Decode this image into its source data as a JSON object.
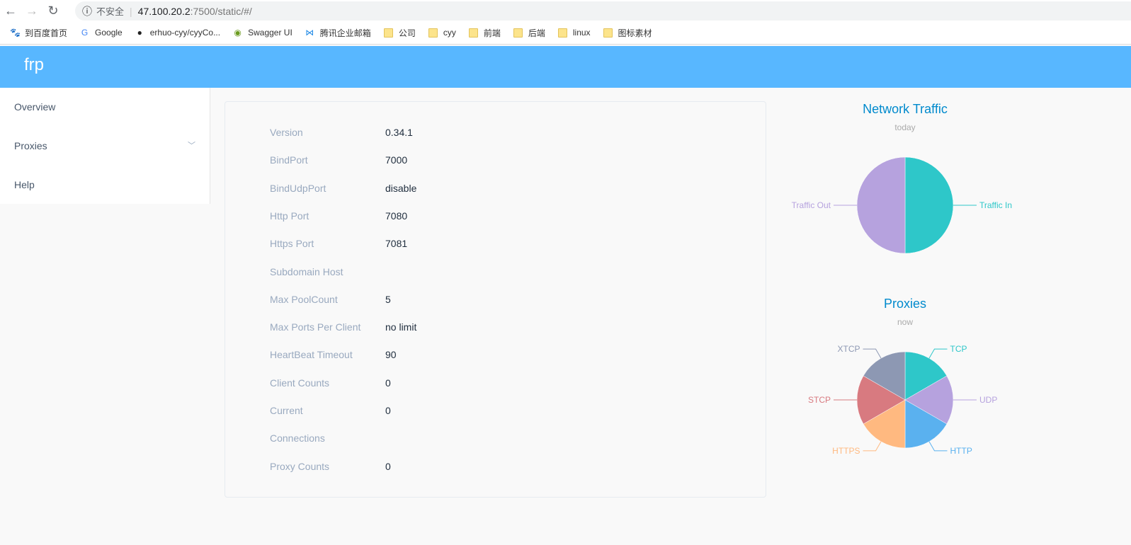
{
  "browser": {
    "url_security": "不安全",
    "url_host": "47.100.20.2",
    "url_path": ":7500/static/#/",
    "bookmarks": [
      {
        "label": "到百度首页",
        "icon": "baidu-icon"
      },
      {
        "label": "Google",
        "icon": "google-icon"
      },
      {
        "label": "erhuo-cyy/cyyCo...",
        "icon": "github-icon"
      },
      {
        "label": "Swagger UI",
        "icon": "swagger-icon"
      },
      {
        "label": "腾讯企业邮箱",
        "icon": "tencent-mail-icon"
      },
      {
        "label": "公司",
        "icon": "folder-icon"
      },
      {
        "label": "cyy",
        "icon": "folder-icon"
      },
      {
        "label": "前端",
        "icon": "folder-icon"
      },
      {
        "label": "后端",
        "icon": "folder-icon"
      },
      {
        "label": "linux",
        "icon": "folder-icon"
      },
      {
        "label": "图标素材",
        "icon": "folder-icon"
      }
    ]
  },
  "header": {
    "title": "frp",
    "color": "#58b7ff"
  },
  "sidebar": {
    "items": [
      {
        "label": "Overview"
      },
      {
        "label": "Proxies"
      },
      {
        "label": "Help"
      }
    ]
  },
  "info": [
    {
      "k": "Version",
      "v": "0.34.1"
    },
    {
      "k": "BindPort",
      "v": "7000"
    },
    {
      "k": "BindUdpPort",
      "v": "disable"
    },
    {
      "k": "Http Port",
      "v": "7080"
    },
    {
      "k": "Https Port",
      "v": "7081"
    },
    {
      "k": "Subdomain Host",
      "v": ""
    },
    {
      "k": "Max PoolCount",
      "v": "5"
    },
    {
      "k": "Max Ports Per Client",
      "v": "no limit"
    },
    {
      "k": "HeartBeat Timeout",
      "v": "90"
    },
    {
      "k": "Client Counts",
      "v": "0"
    },
    {
      "k": "Current",
      "v": "0"
    },
    {
      "k": "Connections",
      "v": ""
    },
    {
      "k": "Proxy Counts",
      "v": "0"
    }
  ],
  "chart_data": [
    {
      "type": "pie",
      "title": "Network Traffic",
      "subtitle": "today",
      "categories": [
        "Traffic In",
        "Traffic Out"
      ],
      "values": [
        0,
        0
      ],
      "colors": [
        "#2ec7c9",
        "#b6a2de"
      ]
    },
    {
      "type": "pie",
      "title": "Proxies",
      "subtitle": "now",
      "categories": [
        "TCP",
        "UDP",
        "HTTP",
        "HTTPS",
        "STCP",
        "XTCP"
      ],
      "values": [
        0,
        0,
        0,
        0,
        0,
        0
      ],
      "colors": [
        "#2ec7c9",
        "#b6a2de",
        "#5ab1ef",
        "#ffb980",
        "#d87a80",
        "#8d98b3"
      ]
    }
  ]
}
